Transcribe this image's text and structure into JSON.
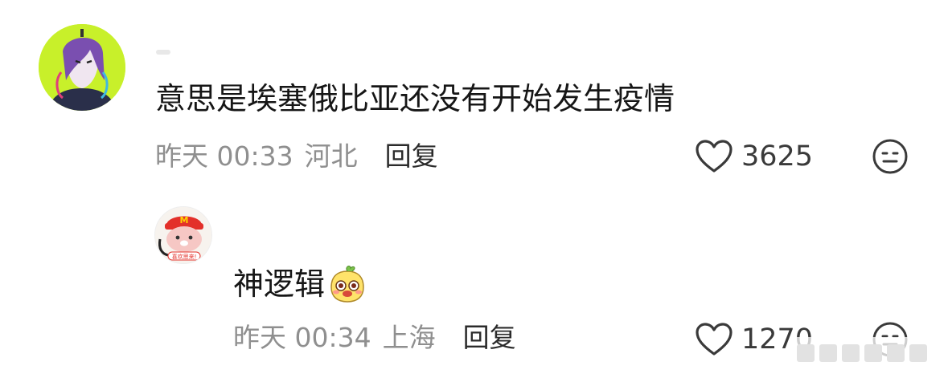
{
  "comments": [
    {
      "avatar_icon": "anime-avatar-icon",
      "text": "意思是埃塞俄比亚还没有开始发生疫情",
      "time": "昨天 00:33",
      "location": "河北",
      "reply_label": "回复",
      "likes": "3625"
    },
    {
      "avatar_icon": "cartoon-bear-avatar-icon",
      "avatar_caption": "喜欢思来!",
      "text": "神逻辑",
      "emoji": "smiling-face-emoji",
      "time": "昨天 00:34",
      "location": "上海",
      "reply_label": "回复",
      "likes": "1270"
    }
  ],
  "colors": {
    "avatar1_bg": "#c8f02a",
    "meta_text": "#8f8f8f",
    "body_text": "#161616"
  }
}
